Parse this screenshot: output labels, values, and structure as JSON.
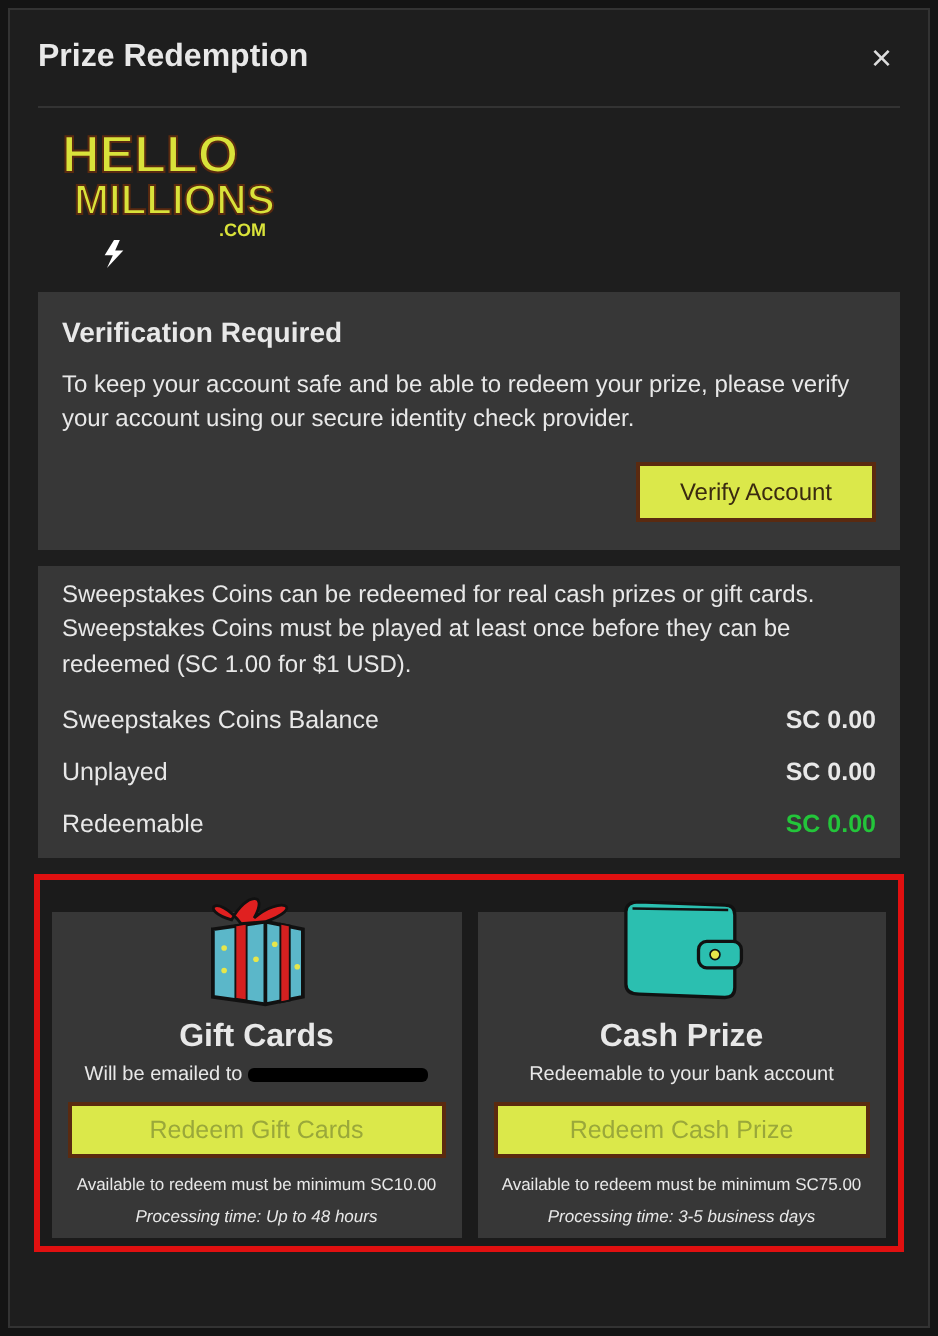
{
  "dialog": {
    "title": "Prize Redemption",
    "close": "×"
  },
  "logo": {
    "line_1": "HELLO",
    "line_2": "MILLIONS",
    "line_3": ".COM"
  },
  "verification": {
    "title": "Verification Required",
    "text": "To keep your account safe and be able to redeem your prize, please verify your account using our secure identity check provider.",
    "button": "Verify Account"
  },
  "info": {
    "text": "Sweepstakes Coins can be redeemed for real cash prizes or gift cards. Sweepstakes Coins must be played at least once before they can be redeemed (SC 1.00 for $1 USD).",
    "rows": [
      {
        "label": "Sweepstakes Coins Balance",
        "value": "SC 0.00",
        "highlight": false
      },
      {
        "label": "Unplayed",
        "value": "SC 0.00",
        "highlight": false
      },
      {
        "label": "Redeemable",
        "value": "SC 0.00",
        "highlight": true
      }
    ]
  },
  "options": [
    {
      "kind": "gift",
      "title": "Gift Cards",
      "subtitle": "Will be emailed to",
      "redacted": true,
      "button": "Redeem Gift Cards",
      "disabled": true,
      "minimum": "Available to redeem must be minimum SC10.00",
      "processing": "Processing time: Up to 48 hours"
    },
    {
      "kind": "wallet",
      "title": "Cash Prize",
      "subtitle": "Redeemable to your bank account",
      "redacted": false,
      "button": "Redeem Cash Prize",
      "disabled": true,
      "minimum": "Available to redeem must be minimum SC75.00",
      "processing": "Processing time: 3-5 business days"
    }
  ]
}
